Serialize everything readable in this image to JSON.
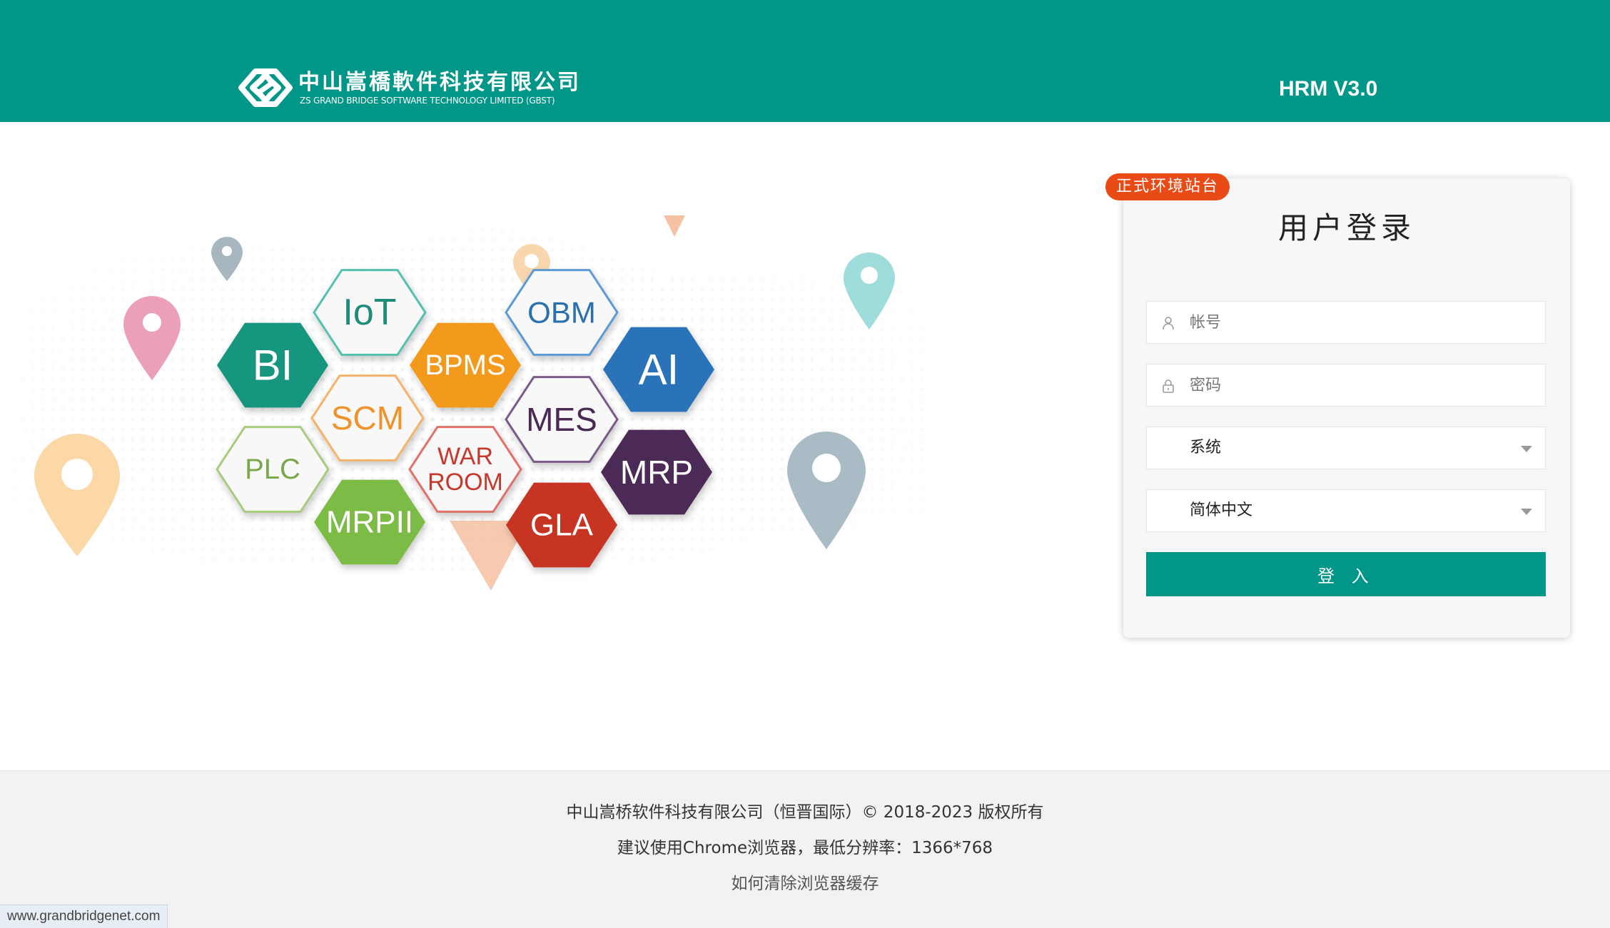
{
  "header": {
    "company_cn": "中山嵩橋軟件科技有限公司",
    "company_en": "ZS GRAND BRIDGE SOFTWARE TECHNOLOGY LIMITED (GBST)",
    "app_version": "HRM V3.0",
    "logo_icon": "gbst-logo-icon"
  },
  "hero": {
    "hexagons": [
      {
        "label": "IoT",
        "style": "white",
        "text_color": "#1f8c7b",
        "border": "#52c1ad"
      },
      {
        "label": "BI",
        "style": "filled",
        "fill": "#16967f",
        "text_color": "#ffffff"
      },
      {
        "label": "BPMS",
        "style": "filled",
        "fill": "#f39a1a",
        "text_color": "#ffffff"
      },
      {
        "label": "OBM",
        "style": "white",
        "text_color": "#2a6fae",
        "border": "#5b9ad6"
      },
      {
        "label": "AI",
        "style": "filled",
        "fill": "#2b73b8",
        "text_color": "#ffffff"
      },
      {
        "label": "SCM",
        "style": "white",
        "text_color": "#f0922a",
        "border": "#f4b36a"
      },
      {
        "label": "MES",
        "style": "white",
        "text_color": "#4a2a55",
        "border": "#7a5a88"
      },
      {
        "label": "PLC",
        "style": "white",
        "text_color": "#7aa84a",
        "border": "#a6cc7b"
      },
      {
        "label": "WAR\nROOM",
        "style": "white",
        "text_color": "#c7372b",
        "border": "#e07168"
      },
      {
        "label": "MRP",
        "style": "filled",
        "fill": "#4b2c55",
        "text_color": "#ffffff"
      },
      {
        "label": "MRPII",
        "style": "filled",
        "fill": "#7dbb46",
        "text_color": "#ffffff"
      },
      {
        "label": "GLA",
        "style": "filled",
        "fill": "#c73624",
        "text_color": "#ffffff"
      }
    ],
    "pins": [
      {
        "name": "grey-pin-icon",
        "color": "#a8b6bf"
      },
      {
        "name": "pink-pin-icon",
        "color": "#ec9fb8"
      },
      {
        "name": "peach-pin-icon",
        "color": "#fbd8a6"
      },
      {
        "name": "teal-pin-icon",
        "color": "#9fdcdc"
      },
      {
        "name": "slate-pin-icon",
        "color": "#a9bcc6"
      },
      {
        "name": "orange-pin-icon",
        "color": "#f3c48f"
      },
      {
        "name": "salmon-triangle-icon",
        "color": "#f6c1a2"
      }
    ]
  },
  "login": {
    "env_badge": "正式环境站台",
    "title": "用户登录",
    "account_placeholder": "帐号",
    "password_placeholder": "密码",
    "system_selected": "系统",
    "language_selected": "简体中文",
    "submit_label": "登 入"
  },
  "footer": {
    "copyright": "中山嵩桥软件科技有限公司（恒晋国际）© 2018-2023 版权所有",
    "browser_hint": "建议使用Chrome浏览器，最低分辨率：1366*768",
    "clear_cache_link": "如何清除浏览器缓存"
  },
  "status_bar": {
    "url": "www.grandbridgenet.com"
  },
  "colors": {
    "primary": "#009688",
    "badge": "#ea4a15",
    "footer_bg": "#f2f2f2"
  }
}
